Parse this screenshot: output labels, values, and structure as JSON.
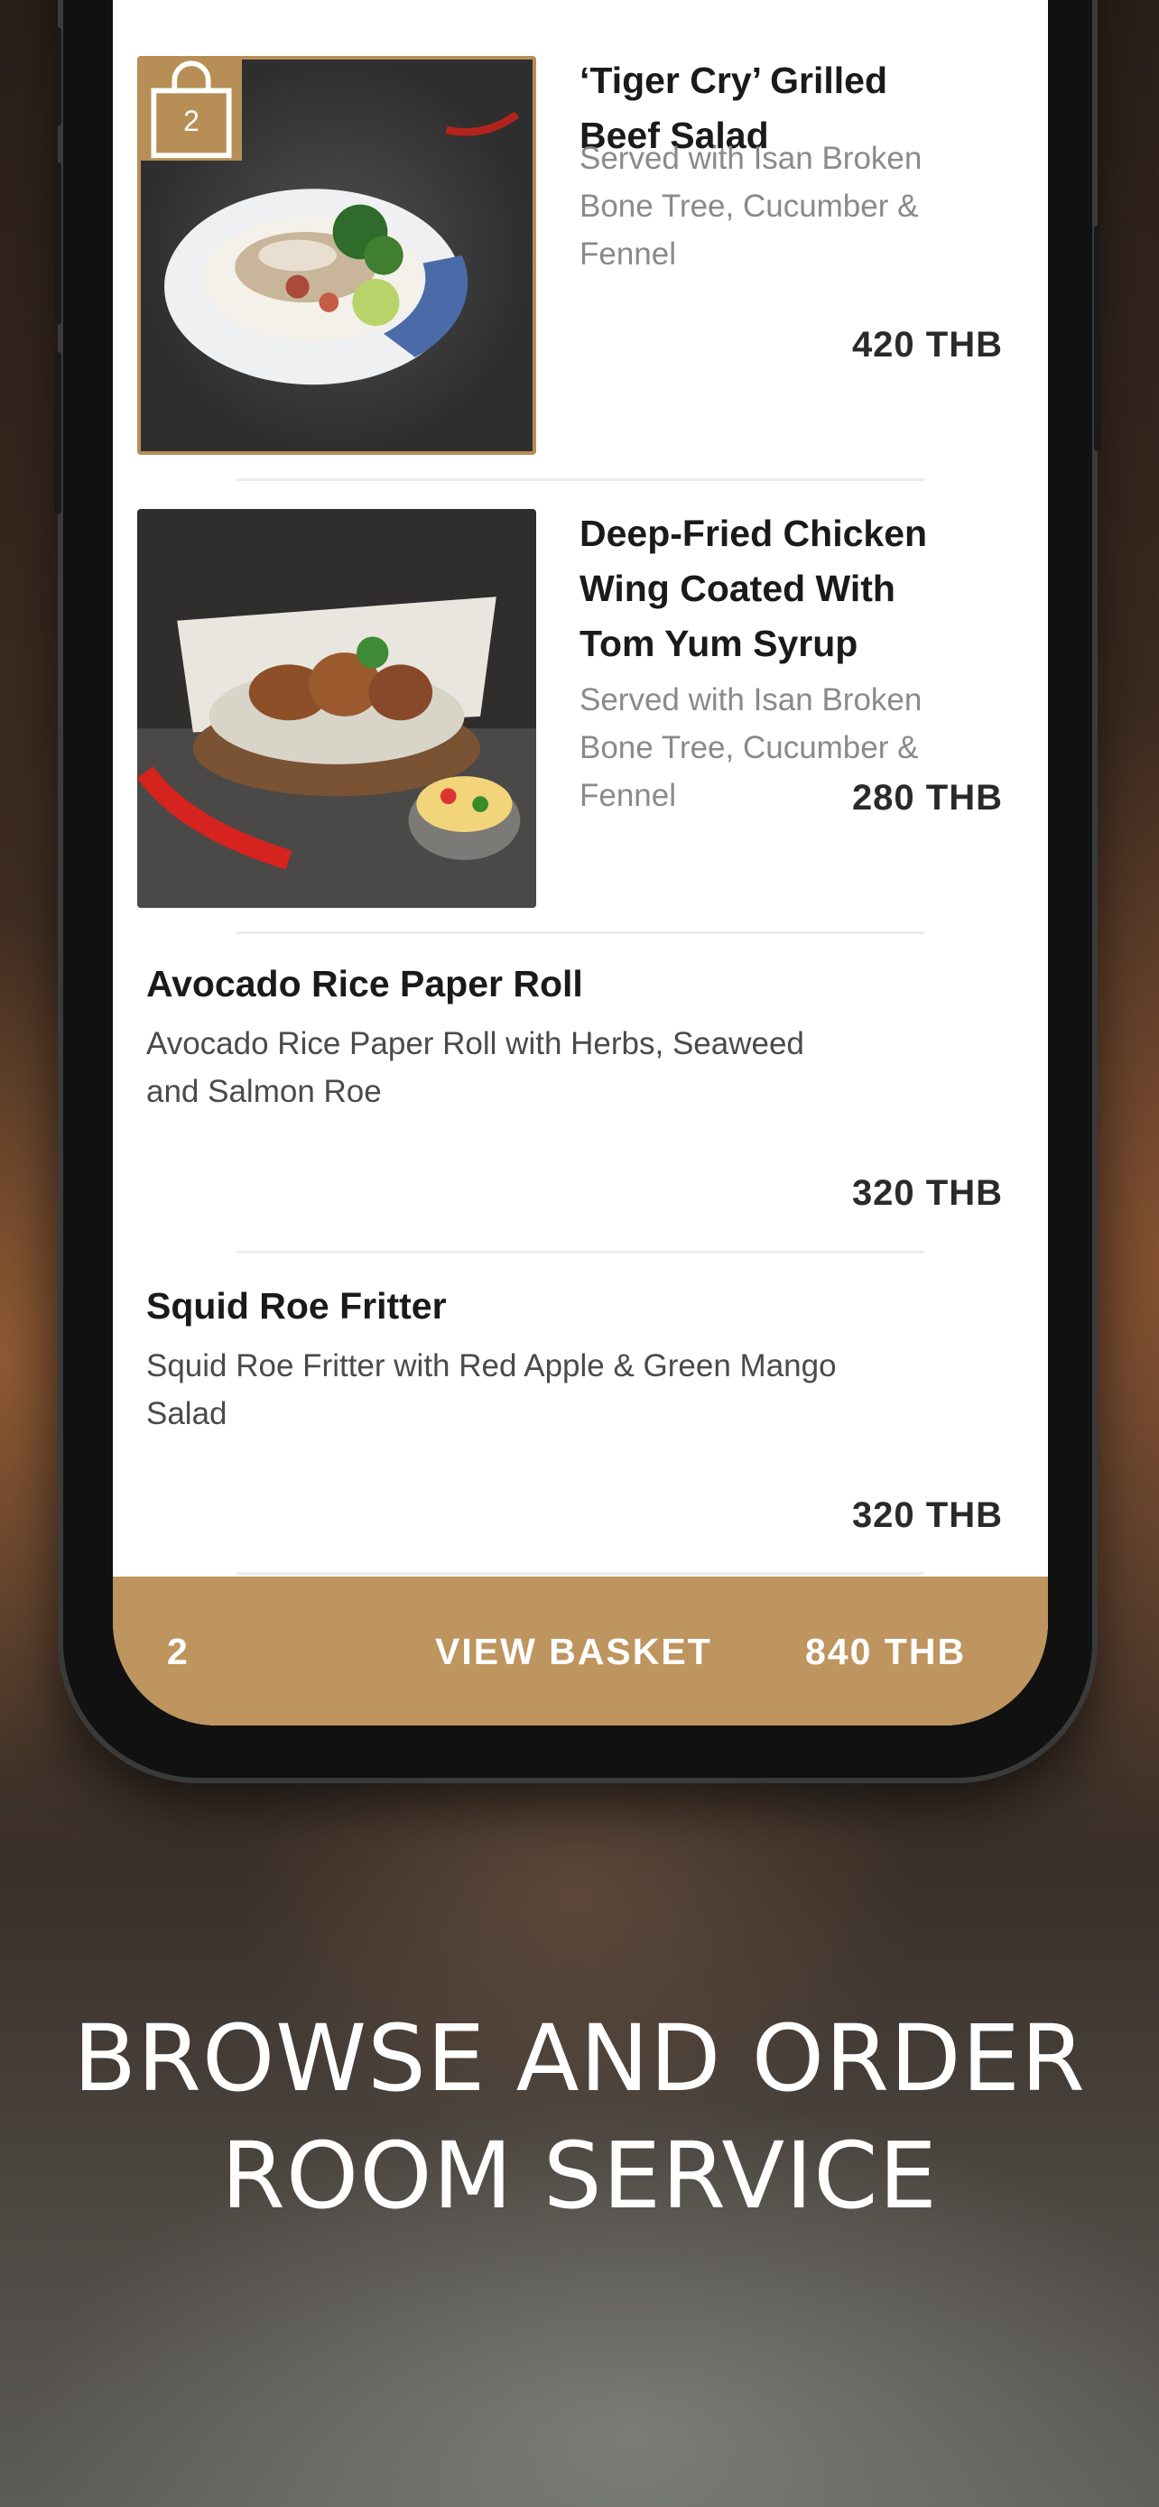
{
  "menu": {
    "items": [
      {
        "title_line1": "‘Tiger Cry’ Grilled",
        "title_line2": "Beef Salad",
        "desc_line1": "Served with Isan Broken",
        "desc_line2": "Bone Tree, Cucumber &",
        "desc_line3": "Fennel",
        "price": "420 THB",
        "cart_count": "2"
      },
      {
        "title_line1": "Deep-Fried Chicken",
        "title_line2": "Wing Coated With",
        "title_line3": "Tom Yum Syrup",
        "desc_line1": "Served with Isan Broken",
        "desc_line2": "Bone Tree, Cucumber &",
        "desc_line3": "Fennel",
        "price": "280 THB"
      },
      {
        "title": "Avocado Rice Paper Roll",
        "desc_line1": "Avocado Rice Paper Roll with Herbs, Seaweed",
        "desc_line2": "and Salmon Roe",
        "price": "320 THB"
      },
      {
        "title": "Squid Roe Fritter",
        "desc_line1": "Squid Roe Fritter with Red Apple & Green Mango",
        "desc_line2": "Salad",
        "price": "320 THB"
      }
    ]
  },
  "basket": {
    "count": "2",
    "label": "VIEW BASKET",
    "total": "840 THB"
  },
  "headline": {
    "line1": "BROWSE AND ORDER",
    "line2": "ROOM SERVICE"
  },
  "colors": {
    "accent": "#be945f",
    "badge": "#b78f56"
  }
}
